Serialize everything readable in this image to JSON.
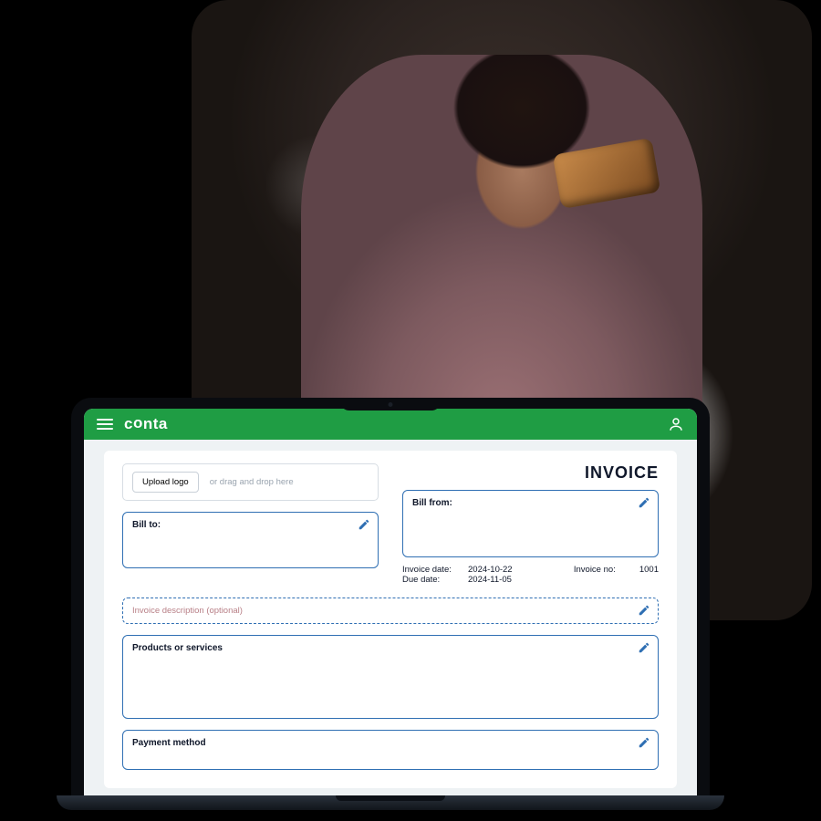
{
  "app": {
    "brand": "conta"
  },
  "invoice": {
    "title": "INVOICE",
    "upload_button": "Upload logo",
    "upload_hint": "or drag and drop here",
    "bill_to_label": "Bill to:",
    "bill_from_label": "Bill from:",
    "invoice_date_label": "Invoice date:",
    "invoice_date_value": "2024-10-22",
    "due_date_label": "Due date:",
    "due_date_value": "2024-11-05",
    "invoice_no_label": "Invoice no:",
    "invoice_no_value": "1001",
    "description_placeholder": "Invoice description (optional)",
    "products_label": "Products or services",
    "payment_label": "Payment method"
  }
}
